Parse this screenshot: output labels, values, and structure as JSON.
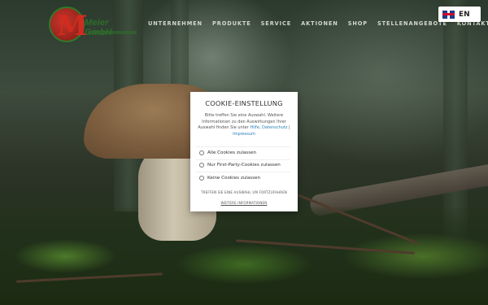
{
  "header": {
    "logo_text": "Meier GmbH",
    "nav": [
      "UNTERNEHMEN",
      "PRODUKTE",
      "SERVICE",
      "AKTIONEN",
      "SHOP",
      "STELLENANGEBOTE",
      "KONTAKT"
    ],
    "language": {
      "code": "EN",
      "flag_icon": "uk-flag-icon"
    }
  },
  "cookie_modal": {
    "title": "COOKIE-EINSTELLUNG",
    "description_prefix": "Bitte treffen Sie eine Auswahl. Weitere Informationen zu den Auswirkungen Ihrer Auswahl finden Sie unter",
    "help_link": "Hilfe",
    "privacy_link": "Datenschutz",
    "separator": "|",
    "imprint_link": "Impressum",
    "options": [
      "Alle Cookies zulassen",
      "Nur First-Party-Cookies zulassen",
      "Keine Cookies zulassen"
    ],
    "hint": "TREFFEN SIE EINE AUSWAHL UM FORTZUFAHREN",
    "more_info": "WEITERE INFORMATIONEN"
  },
  "colors": {
    "link": "#2a7fb8",
    "brand_red": "#d12b1f",
    "brand_green": "#2e6d2a"
  }
}
